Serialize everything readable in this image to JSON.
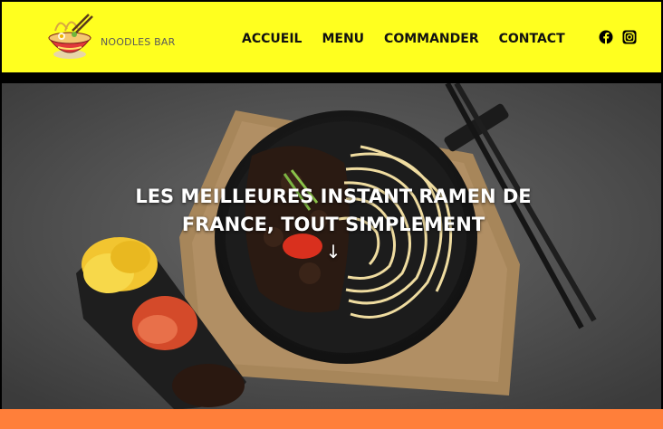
{
  "header": {
    "brand": "NOODLES BAR",
    "logo_icon": "noodle-bowl-logo-icon",
    "background": "#ffff1f"
  },
  "nav": {
    "items": [
      "ACCUEIL",
      "MENU",
      "COMMANDER",
      "CONTACT"
    ]
  },
  "social": {
    "icons": [
      "facebook-icon",
      "instagram-icon"
    ]
  },
  "hero": {
    "title": "LES MEILLEURES INSTANT RAMEN DE FRANCE, TOUT SIMPLEMENT",
    "arrow": "↓"
  },
  "colors": {
    "accent_yellow": "#ffff1f",
    "footer_orange": "#ff7f3a"
  }
}
